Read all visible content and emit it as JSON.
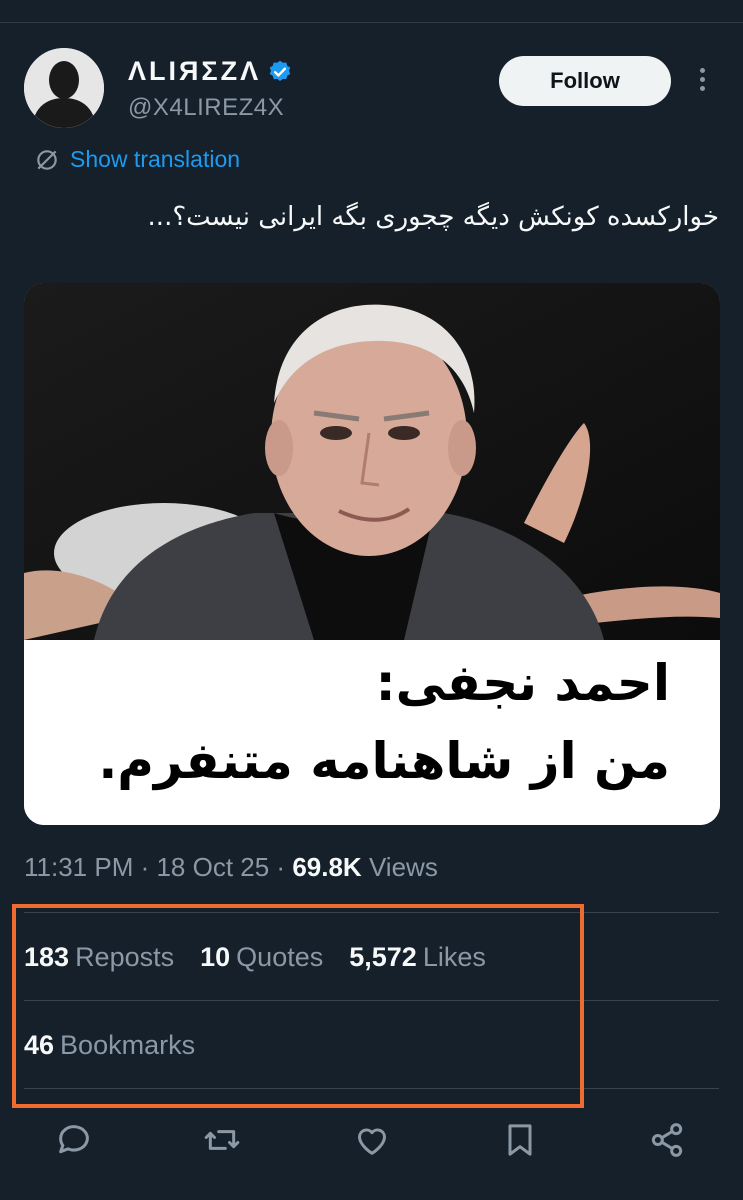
{
  "author": {
    "display_name": "ΛLIЯΣZΛ",
    "handle": "@X4LIREZ4X",
    "verified_icon": "verified-badge-icon"
  },
  "follow_label": "Follow",
  "translation_label": "Show translation",
  "tweet_text": "خوارکسده کونکش دیگه چجوری بگه ایرانی نیست؟...",
  "media": {
    "caption_line1": "احمد نجفی:",
    "caption_line2": "من از شاهنامه متنفرم."
  },
  "meta": {
    "time": "11:31 PM",
    "sep1": " · ",
    "date": "18 Oct 25",
    "sep2": " · ",
    "views_count": "69.8K",
    "views_label": "Views"
  },
  "stats": {
    "reposts_count": "183",
    "reposts_label": "Reposts",
    "quotes_count": "10",
    "quotes_label": "Quotes",
    "likes_count": "5,572",
    "likes_label": "Likes",
    "bookmarks_count": "46",
    "bookmarks_label": "Bookmarks"
  },
  "actions": [
    "reply-icon",
    "repost-icon",
    "like-icon",
    "bookmark-icon",
    "share-icon"
  ],
  "colors": {
    "background": "#15202b",
    "accent": "#1d9bf0",
    "highlight": "#f06a31",
    "muted": "#8b98a5"
  }
}
